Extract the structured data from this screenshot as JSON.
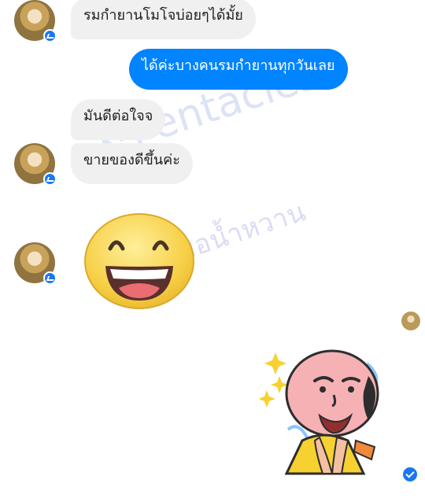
{
  "messages": [
    {
      "id": "m1",
      "sender": "contact",
      "text": "รมกำยานโมโจบ่อยๆได้มั้ย"
    },
    {
      "id": "m2",
      "sender": "me",
      "text": "ได้ค่ะบางคนรมกำยานทุกวันเลย"
    },
    {
      "id": "m3",
      "sender": "contact",
      "text": "มันดีต่อใจจ"
    },
    {
      "id": "m4",
      "sender": "contact",
      "text": "ขายของดีขึ้นค่ะ"
    }
  ],
  "watermarks": {
    "primary": "X-Pentacles",
    "secondary": "หมอน้ำหวาน"
  },
  "colors": {
    "outgoing_bubble": "#0084ff",
    "incoming_bubble": "#f1f0f0",
    "messenger_badge": "#1877f2"
  },
  "icons": {
    "avatar_badge": "messenger-badge-icon",
    "emoji": "laughing-emoji-icon",
    "sticker": "thank-you-sticker-icon",
    "seen": "seen-check-icon"
  }
}
